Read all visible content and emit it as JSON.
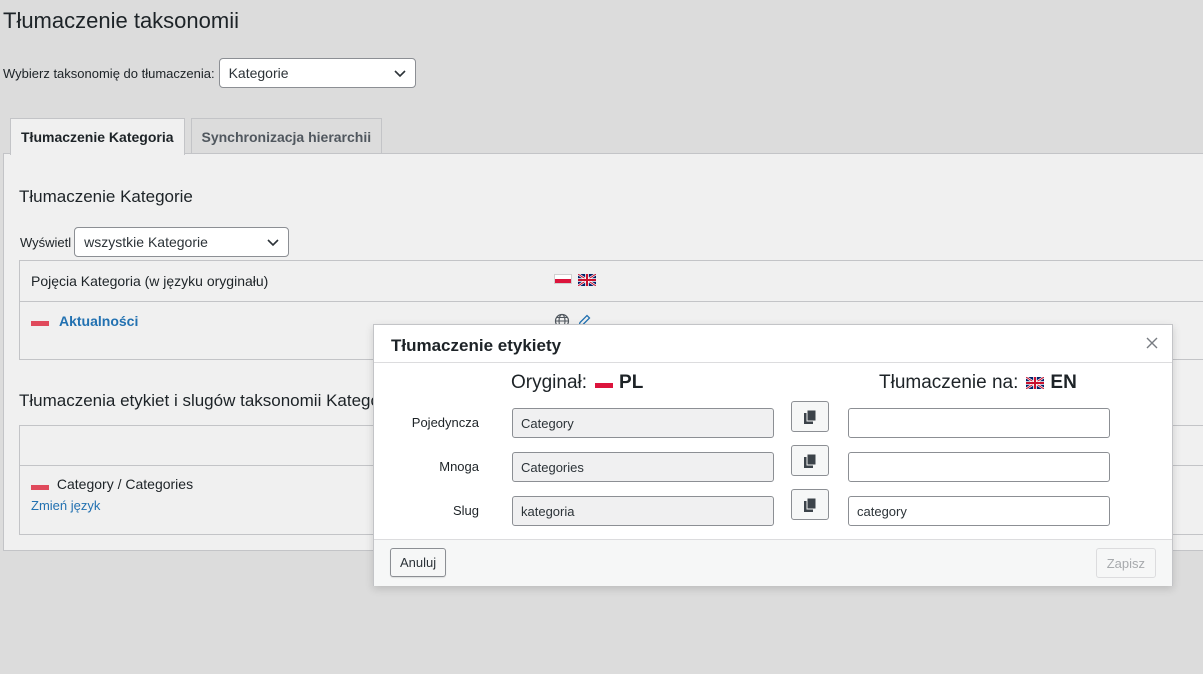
{
  "page": {
    "title": "Tłumaczenie taksonomii",
    "taxonomy_select_label": "Wybierz taksonomię do tłumaczenia:",
    "taxonomy_selected": "Kategorie"
  },
  "tabs": [
    {
      "label": "Tłumaczenie Kategoria",
      "active": true
    },
    {
      "label": "Synchronizacja hierarchii",
      "active": false
    }
  ],
  "panel": {
    "section1_title": "Tłumaczenie Kategorie",
    "display_label": "Wyświetl",
    "display_selected": "wszystkie Kategorie",
    "table1_header": "Pojęcia Kategoria (w języku oryginału)",
    "term_name": "Aktualności",
    "section2_title": "Tłumaczenia etykiet i slugów taksonomii Kategorie",
    "table2_row_label": "Category / Categories",
    "table2_row_link": "Zmień język"
  },
  "modal": {
    "title": "Tłumaczenie etykiety",
    "original_label": "Oryginał:",
    "original_lang": "PL",
    "translation_label": "Tłumaczenie na:",
    "translation_lang": "EN",
    "fields": [
      {
        "label": "Pojedyncza",
        "original": "Category",
        "translation": ""
      },
      {
        "label": "Mnoga",
        "original": "Categories",
        "translation": ""
      },
      {
        "label": "Slug",
        "original": "kategoria",
        "translation": "category"
      }
    ],
    "cancel_label": "Anuluj",
    "save_label": "Zapisz"
  },
  "colors": {
    "background": "#dcdcdc",
    "link": "#2271b1",
    "flag_pl_red": "#dc143c"
  }
}
